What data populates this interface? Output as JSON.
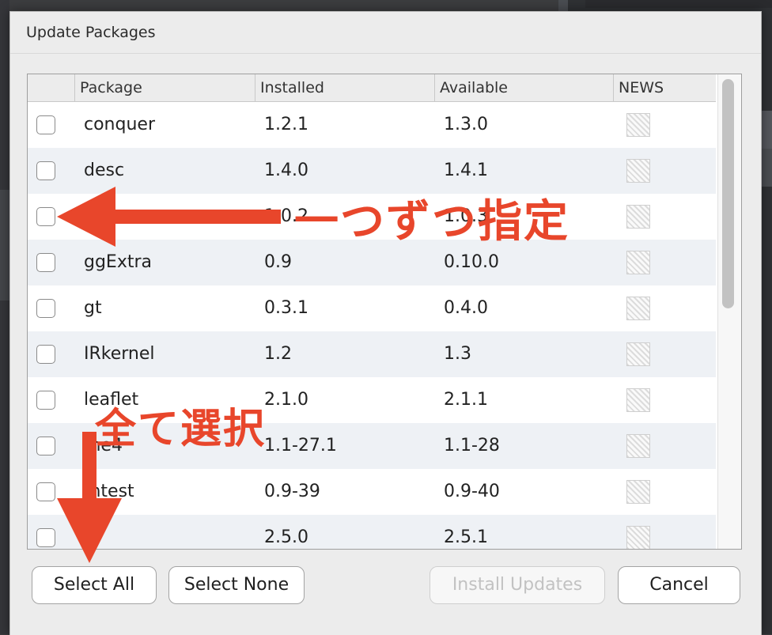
{
  "dialog": {
    "title": "Update Packages"
  },
  "table": {
    "headers": [
      "Package",
      "Installed",
      "Available",
      "NEWS"
    ],
    "rows": [
      {
        "package": "conquer",
        "installed": "1.2.1",
        "available": "1.3.0"
      },
      {
        "package": "desc",
        "installed": "1.4.0",
        "available": "1.4.1"
      },
      {
        "package": "",
        "installed": "1.0.2",
        "available": "1.0.3"
      },
      {
        "package": "ggExtra",
        "installed": "0.9",
        "available": "0.10.0"
      },
      {
        "package": "gt",
        "installed": "0.3.1",
        "available": "0.4.0"
      },
      {
        "package": "IRkernel",
        "installed": "1.2",
        "available": "1.3"
      },
      {
        "package": "leaflet",
        "installed": "2.1.0",
        "available": "2.1.1"
      },
      {
        "package": "me4",
        "installed": "1.1-27.1",
        "available": "1.1-28"
      },
      {
        "package": "mtest",
        "installed": "0.9-39",
        "available": "0.9-40"
      },
      {
        "package": "o",
        "installed": "2.5.0",
        "available": "2.5.1"
      }
    ]
  },
  "buttons": {
    "select_all": "Select All",
    "select_none": "Select None",
    "install_updates": "Install Updates",
    "cancel": "Cancel"
  },
  "annotations": {
    "one_by_one": "一つずつ指定",
    "select_all_jp": "全て選択",
    "color": "#e8462b"
  }
}
